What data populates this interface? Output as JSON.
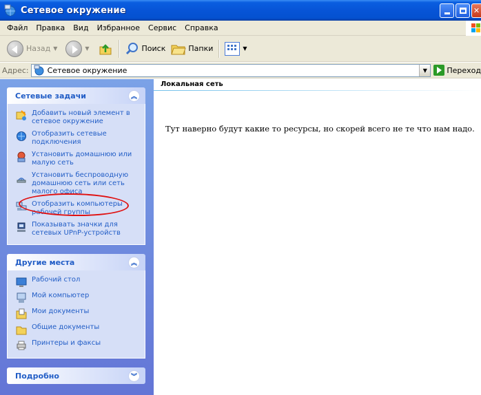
{
  "window": {
    "title": "Сетевое окружение"
  },
  "menu": [
    "Файл",
    "Правка",
    "Вид",
    "Избранное",
    "Сервис",
    "Справка"
  ],
  "toolbar": {
    "back_label": "Назад",
    "search_label": "Поиск",
    "folders_label": "Папки"
  },
  "address": {
    "label": "Адрес:",
    "value": "Сетевое окружение",
    "go_label": "Переход"
  },
  "network_tasks": {
    "title": "Сетевые задачи",
    "items": [
      {
        "label": "Добавить новый элемент в сетевое окружение",
        "icon": "add-network-place-icon"
      },
      {
        "label": "Отобразить сетевые подключения",
        "icon": "network-connections-icon"
      },
      {
        "label": "Установить домашнюю или малую сеть",
        "icon": "home-network-icon"
      },
      {
        "label": "Установить беспроводную домашнюю сеть или сеть малого офиса",
        "icon": "wireless-network-icon"
      },
      {
        "label": "Отобразить компьютеры рабочей группы",
        "icon": "workgroup-computers-icon"
      },
      {
        "label": "Показывать значки для сетевых UPnP-устройств",
        "icon": "upnp-devices-icon"
      }
    ]
  },
  "other_places": {
    "title": "Другие места",
    "items": [
      {
        "label": "Рабочий стол",
        "icon": "desktop-icon"
      },
      {
        "label": "Мой компьютер",
        "icon": "my-computer-icon"
      },
      {
        "label": "Мои документы",
        "icon": "my-documents-icon"
      },
      {
        "label": "Общие документы",
        "icon": "shared-documents-icon"
      },
      {
        "label": "Принтеры и факсы",
        "icon": "printers-faxes-icon"
      }
    ]
  },
  "details": {
    "title": "Подробно"
  },
  "content": {
    "group_title": "Локальная сеть",
    "note": "Тут наверно будут какие то ресурсы, но скорей всего не те что нам надо."
  }
}
